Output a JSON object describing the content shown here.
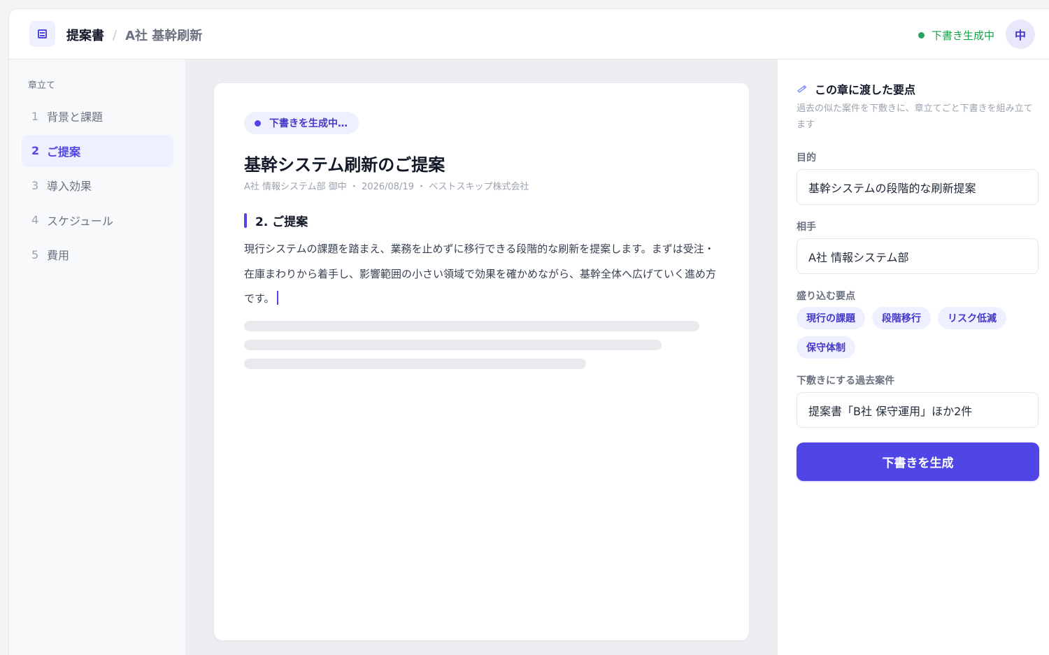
{
  "header": {
    "breadcrumb_root": "提案書",
    "breadcrumb_sep": "/",
    "breadcrumb_current": "A社 基幹刷新",
    "status": "下書き生成中",
    "avatar": "中"
  },
  "sidebar": {
    "title": "章立て",
    "items": [
      {
        "num": "1",
        "label": "背景と課題"
      },
      {
        "num": "2",
        "label": "ご提案"
      },
      {
        "num": "3",
        "label": "導入効果"
      },
      {
        "num": "4",
        "label": "スケジュール"
      },
      {
        "num": "5",
        "label": "費用"
      }
    ]
  },
  "document": {
    "badge": "下書きを生成中…",
    "title": "基幹システム刷新のご提案",
    "meta": "A社 情報システム部 御中 ・ 2026/08/19 ・ ベストスキップ株式会社",
    "section_title": "2. ご提案",
    "paragraph": "現行システムの課題を踏まえ、業務を止めずに移行できる段階的な刷新を提案します。まずは受注・在庫まわりから着手し、影響範囲の小さい領域で効果を確かめながら、基幹全体へ広げていく進め方です。"
  },
  "panel": {
    "title": "この章に渡した要点",
    "description": "過去の似た案件を下敷きに、章立てごと下書きを組み立てます",
    "purpose_label": "目的",
    "purpose_value": "基幹システムの段階的な刷新提案",
    "recipient_label": "相手",
    "recipient_value": "A社 情報システム部",
    "points_label": "盛り込む要点",
    "points": [
      "現行の課題",
      "段階移行",
      "リスク低減",
      "保守体制"
    ],
    "reference_label": "下敷きにする過去案件",
    "reference_value": "提案書「B社 保守運用」ほか2件",
    "generate_button": "下書きを生成"
  },
  "colors": {
    "accent": "#4f46e5",
    "status_green": "#16a34a"
  }
}
